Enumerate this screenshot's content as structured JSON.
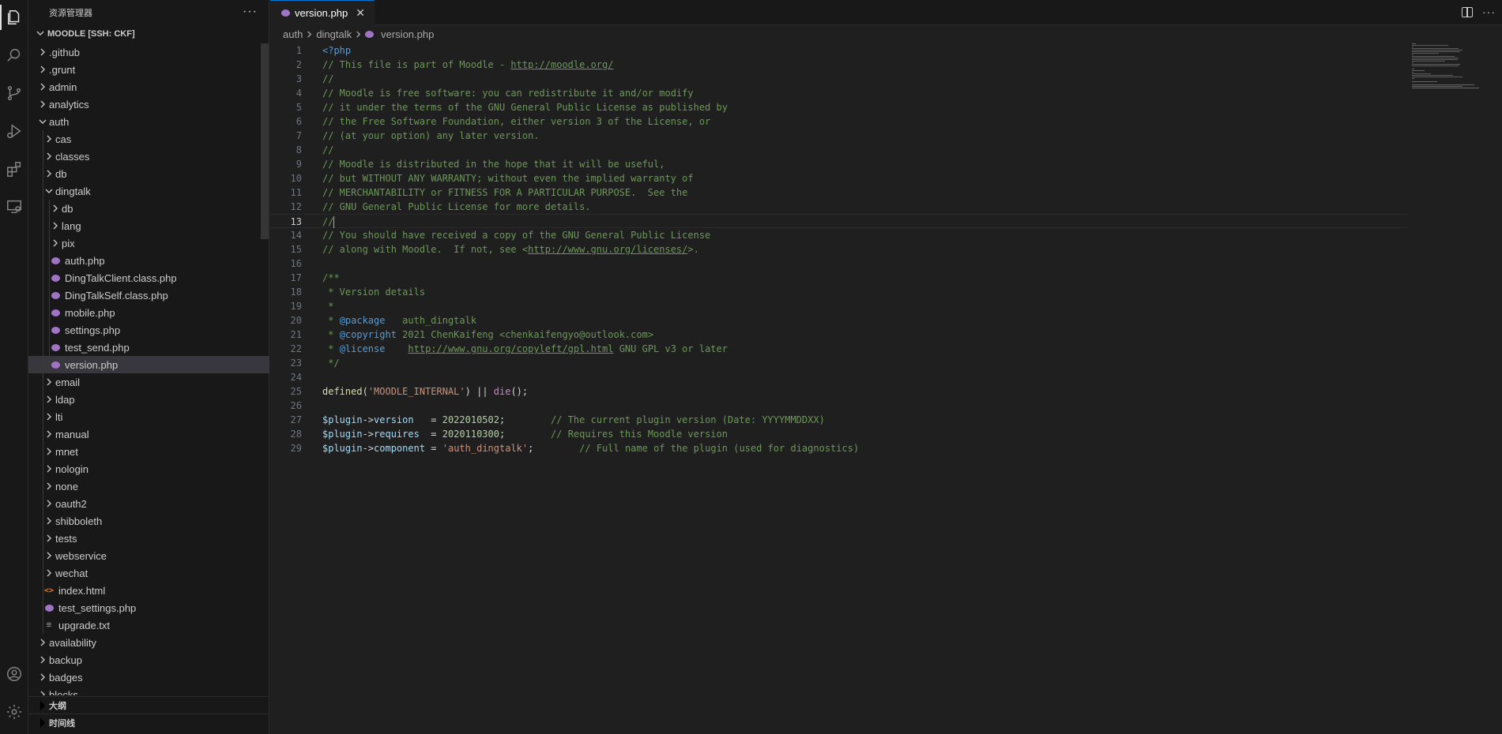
{
  "activity_bar": {
    "items": [
      "explorer-icon",
      "search-icon",
      "source-control-icon",
      "run-debug-icon",
      "extensions-icon",
      "remote-explorer-icon"
    ],
    "bottom": [
      "account-icon",
      "settings-gear-icon"
    ]
  },
  "sidebar": {
    "title": "资源管理器",
    "more": "···",
    "workspace": "MOODLE [SSH: CKF]",
    "tree": [
      {
        "label": ".github",
        "depth": 1,
        "type": "folder",
        "expanded": false
      },
      {
        "label": ".grunt",
        "depth": 1,
        "type": "folder",
        "expanded": false
      },
      {
        "label": "admin",
        "depth": 1,
        "type": "folder",
        "expanded": false
      },
      {
        "label": "analytics",
        "depth": 1,
        "type": "folder",
        "expanded": false
      },
      {
        "label": "auth",
        "depth": 1,
        "type": "folder",
        "expanded": true
      },
      {
        "label": "cas",
        "depth": 2,
        "type": "folder",
        "expanded": false
      },
      {
        "label": "classes",
        "depth": 2,
        "type": "folder",
        "expanded": false
      },
      {
        "label": "db",
        "depth": 2,
        "type": "folder",
        "expanded": false
      },
      {
        "label": "dingtalk",
        "depth": 2,
        "type": "folder",
        "expanded": true
      },
      {
        "label": "db",
        "depth": 3,
        "type": "folder",
        "expanded": false
      },
      {
        "label": "lang",
        "depth": 3,
        "type": "folder",
        "expanded": false
      },
      {
        "label": "pix",
        "depth": 3,
        "type": "folder",
        "expanded": false
      },
      {
        "label": "auth.php",
        "depth": 3,
        "type": "php"
      },
      {
        "label": "DingTalkClient.class.php",
        "depth": 3,
        "type": "php"
      },
      {
        "label": "DingTalkSelf.class.php",
        "depth": 3,
        "type": "php"
      },
      {
        "label": "mobile.php",
        "depth": 3,
        "type": "php"
      },
      {
        "label": "settings.php",
        "depth": 3,
        "type": "php"
      },
      {
        "label": "test_send.php",
        "depth": 3,
        "type": "php"
      },
      {
        "label": "version.php",
        "depth": 3,
        "type": "php",
        "selected": true
      },
      {
        "label": "email",
        "depth": 2,
        "type": "folder",
        "expanded": false
      },
      {
        "label": "ldap",
        "depth": 2,
        "type": "folder",
        "expanded": false
      },
      {
        "label": "lti",
        "depth": 2,
        "type": "folder",
        "expanded": false
      },
      {
        "label": "manual",
        "depth": 2,
        "type": "folder",
        "expanded": false
      },
      {
        "label": "mnet",
        "depth": 2,
        "type": "folder",
        "expanded": false
      },
      {
        "label": "nologin",
        "depth": 2,
        "type": "folder",
        "expanded": false
      },
      {
        "label": "none",
        "depth": 2,
        "type": "folder",
        "expanded": false
      },
      {
        "label": "oauth2",
        "depth": 2,
        "type": "folder",
        "expanded": false
      },
      {
        "label": "shibboleth",
        "depth": 2,
        "type": "folder",
        "expanded": false
      },
      {
        "label": "tests",
        "depth": 2,
        "type": "folder",
        "expanded": false
      },
      {
        "label": "webservice",
        "depth": 2,
        "type": "folder",
        "expanded": false
      },
      {
        "label": "wechat",
        "depth": 2,
        "type": "folder",
        "expanded": false
      },
      {
        "label": "index.html",
        "depth": 2,
        "type": "html"
      },
      {
        "label": "test_settings.php",
        "depth": 2,
        "type": "php"
      },
      {
        "label": "upgrade.txt",
        "depth": 2,
        "type": "txt"
      },
      {
        "label": "availability",
        "depth": 1,
        "type": "folder",
        "expanded": false
      },
      {
        "label": "backup",
        "depth": 1,
        "type": "folder",
        "expanded": false
      },
      {
        "label": "badges",
        "depth": 1,
        "type": "folder",
        "expanded": false
      },
      {
        "label": "blocks",
        "depth": 1,
        "type": "folder",
        "expanded": false
      }
    ],
    "outline_label": "大纲",
    "timeline_label": "时间线"
  },
  "editor": {
    "tab": {
      "label": "version.php",
      "close": "✕"
    },
    "tab_more": "···",
    "breadcrumb": [
      "auth",
      "dingtalk",
      "version.php"
    ],
    "current_line": 13,
    "lines": [
      [
        [
          "tag",
          "<?php"
        ]
      ],
      [
        [
          "cm",
          "// This file is part of Moodle - "
        ],
        [
          "cm-link",
          "http://moodle.org/"
        ]
      ],
      [
        [
          "cm",
          "//"
        ]
      ],
      [
        [
          "cm",
          "// Moodle is free software: you can redistribute it and/or modify"
        ]
      ],
      [
        [
          "cm",
          "// it under the terms of the GNU General Public License as published by"
        ]
      ],
      [
        [
          "cm",
          "// the Free Software Foundation, either version 3 of the License, or"
        ]
      ],
      [
        [
          "cm",
          "// (at your option) any later version."
        ]
      ],
      [
        [
          "cm",
          "//"
        ]
      ],
      [
        [
          "cm",
          "// Moodle is distributed in the hope that it will be useful,"
        ]
      ],
      [
        [
          "cm",
          "// but WITHOUT ANY WARRANTY; without even the implied warranty of"
        ]
      ],
      [
        [
          "cm",
          "// MERCHANTABILITY or FITNESS FOR A PARTICULAR PURPOSE.  See the"
        ]
      ],
      [
        [
          "cm",
          "// GNU General Public License for more details."
        ]
      ],
      [
        [
          "cm",
          "//"
        ],
        [
          "cursor",
          ""
        ]
      ],
      [
        [
          "cm",
          "// You should have received a copy of the GNU General Public License"
        ]
      ],
      [
        [
          "cm",
          "// along with Moodle.  If not, see <"
        ],
        [
          "cm-link",
          "http://www.gnu.org/licenses/"
        ],
        [
          "cm",
          ">."
        ]
      ],
      [],
      [
        [
          "cm",
          "/**"
        ]
      ],
      [
        [
          "cm",
          " * Version details"
        ]
      ],
      [
        [
          "cm",
          " *"
        ]
      ],
      [
        [
          "cm",
          " * "
        ],
        [
          "doctag",
          "@package"
        ],
        [
          "cm",
          "   auth_dingtalk"
        ]
      ],
      [
        [
          "cm",
          " * "
        ],
        [
          "doctag",
          "@copyright"
        ],
        [
          "cm",
          " 2021 ChenKaifeng <chenkaifengyo@outlook.com>"
        ]
      ],
      [
        [
          "cm",
          " * "
        ],
        [
          "doctag",
          "@license"
        ],
        [
          "cm",
          "    "
        ],
        [
          "cm-link",
          "http://www.gnu.org/copyleft/gpl.html"
        ],
        [
          "cm",
          " GNU GPL v3 or later"
        ]
      ],
      [
        [
          "cm",
          " */"
        ]
      ],
      [],
      [
        [
          "fn",
          "defined"
        ],
        [
          "op",
          "("
        ],
        [
          "str",
          "'MOODLE_INTERNAL'"
        ],
        [
          "op",
          ") || "
        ],
        [
          "kw",
          "die"
        ],
        [
          "op",
          "();"
        ]
      ],
      [],
      [
        [
          "var",
          "$plugin"
        ],
        [
          "op",
          "->"
        ],
        [
          "var",
          "version"
        ],
        [
          "op",
          "   = "
        ],
        [
          "num",
          "2022010502"
        ],
        [
          "op",
          ";        "
        ],
        [
          "cm",
          "// The current plugin version (Date: YYYYMMDDXX)"
        ]
      ],
      [
        [
          "var",
          "$plugin"
        ],
        [
          "op",
          "->"
        ],
        [
          "var",
          "requires"
        ],
        [
          "op",
          "  = "
        ],
        [
          "num",
          "2020110300"
        ],
        [
          "op",
          ";        "
        ],
        [
          "cm",
          "// Requires this Moodle version"
        ]
      ],
      [
        [
          "var",
          "$plugin"
        ],
        [
          "op",
          "->"
        ],
        [
          "var",
          "component"
        ],
        [
          "op",
          " = "
        ],
        [
          "str",
          "'auth_dingtalk'"
        ],
        [
          "op",
          ";        "
        ],
        [
          "cm",
          "// Full name of the plugin (used for diagnostics)"
        ]
      ]
    ]
  }
}
